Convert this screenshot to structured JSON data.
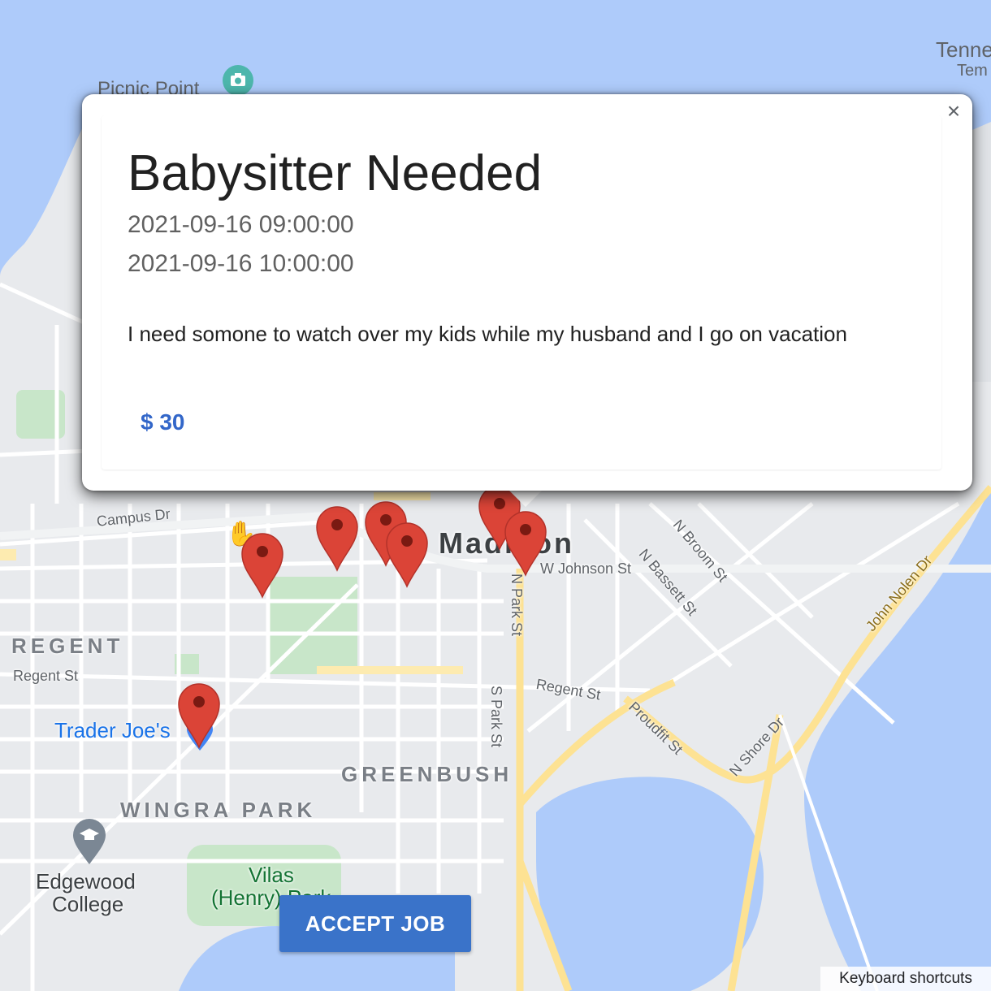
{
  "map": {
    "labels": {
      "picnic_point": "Picnic Point",
      "tenney_1": "Tenne",
      "tenney_2": "Tem",
      "regent_area": "REGENT",
      "regent_st_west": "Regent St",
      "trader_joes": "Trader Joe's",
      "wingra_park": "WINGRA PARK",
      "greenbush": "GREENBUSH",
      "edgewood_1": "Edgewood",
      "edgewood_2": "College",
      "vilas_1": "Vilas",
      "vilas_2": "(Henry) Park",
      "campus_dr": "Campus Dr",
      "madison": "Madison",
      "w_johnson": "W Johnson St",
      "n_park": "N Park St",
      "s_park": "S Park St",
      "regent_st_east": "Regent St",
      "proudfit": "Proudfit St",
      "n_shore": "N Shore Dr",
      "n_broom": "N Broom St",
      "n_bassett": "N Bassett St",
      "john_nolen": "John Nolen Dr"
    },
    "colors": {
      "water": "#aecbfa",
      "land": "#e8eaed",
      "park": "#c8e6c9",
      "highway": "#fde293",
      "marker": "#db4437"
    },
    "markers": [
      "job-marker",
      "job-marker",
      "job-marker",
      "job-marker",
      "job-marker",
      "job-marker",
      "job-marker"
    ]
  },
  "job": {
    "title": "Babysitter Needed",
    "start": "2021-09-16 09:00:00",
    "end": "2021-09-16 10:00:00",
    "description": "I need somone to watch over my kids while my husband and I go on vacation",
    "pay": "$ 30"
  },
  "close_icon": "×",
  "accept_label": "ACCEPT JOB",
  "keyboard_shortcuts": "Keyboard shortcuts"
}
